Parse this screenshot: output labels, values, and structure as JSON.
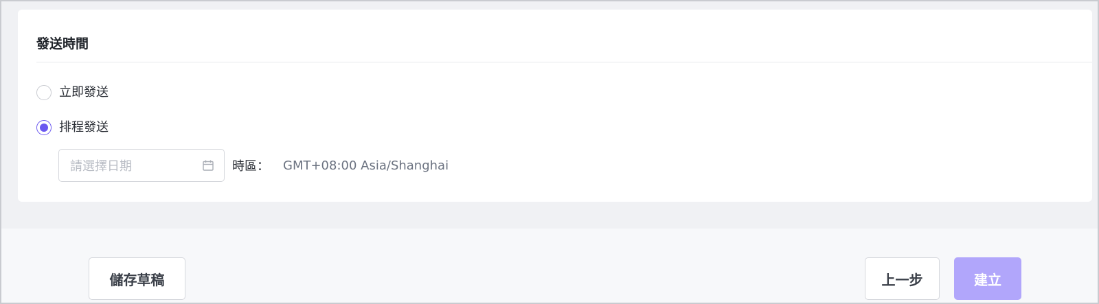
{
  "section": {
    "title": "發送時間"
  },
  "options": [
    {
      "label": "立即發送",
      "checked": false
    },
    {
      "label": "排程發送",
      "checked": true
    }
  ],
  "date_input": {
    "placeholder": "請選擇日期",
    "value": "",
    "icon": "calendar-icon"
  },
  "timezone": {
    "label": "時區：",
    "value": "GMT+08:00 Asia/Shanghai"
  },
  "footer": {
    "save_draft_label": "儲存草稿",
    "prev_label": "上一步",
    "create_label": "建立",
    "create_disabled": true
  },
  "colors": {
    "accent": "#6b58f0",
    "create_disabled_bg": "#b1a6fb"
  }
}
